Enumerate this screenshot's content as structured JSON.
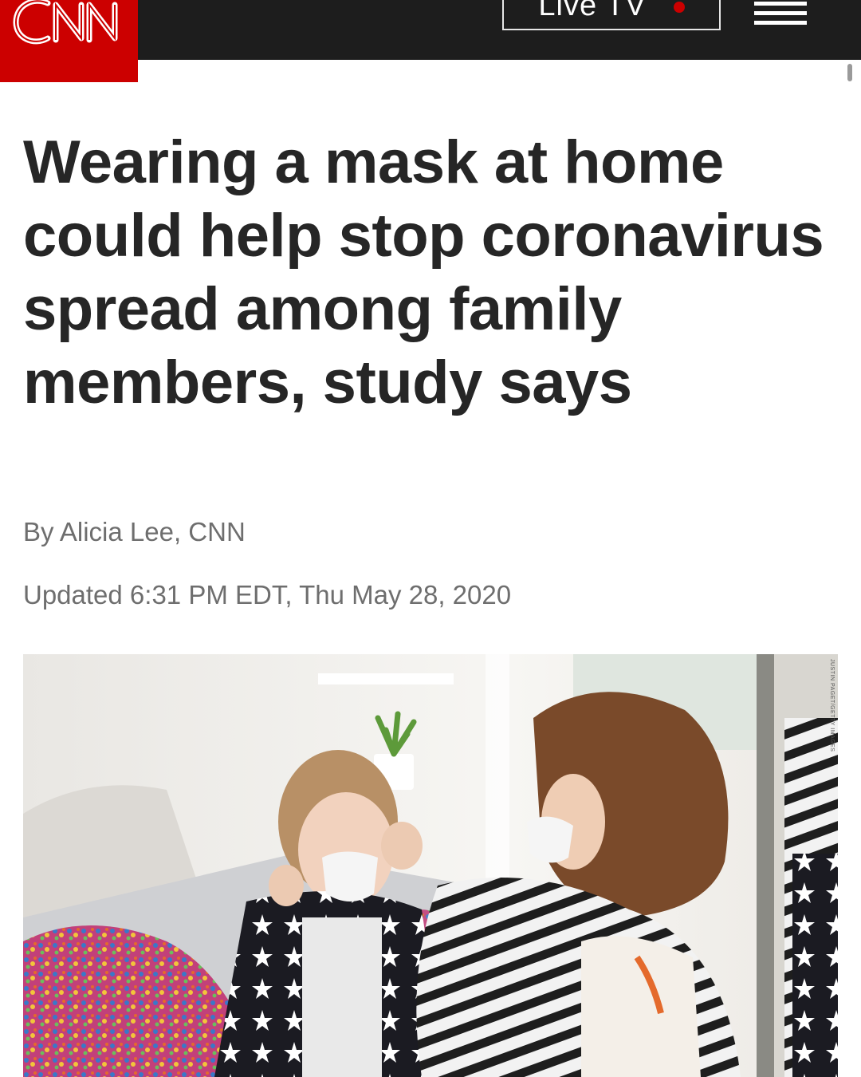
{
  "header": {
    "logo_text": "CNN",
    "live_tv_label": "Live TV",
    "menu_icon": "hamburger-menu-icon",
    "brand_color": "#cc0000",
    "bar_color": "#1d1d1d"
  },
  "article": {
    "headline": "Wearing a mask at home could help stop coronavirus spread among family members, study says",
    "byline": "By Alicia Lee, CNN",
    "updated": "Updated 6:31 PM EDT, Thu May 28, 2020",
    "photo": {
      "description_icon": "article-photo",
      "credit": "JUSTIN PAGET/GETTY IMAGES"
    }
  }
}
